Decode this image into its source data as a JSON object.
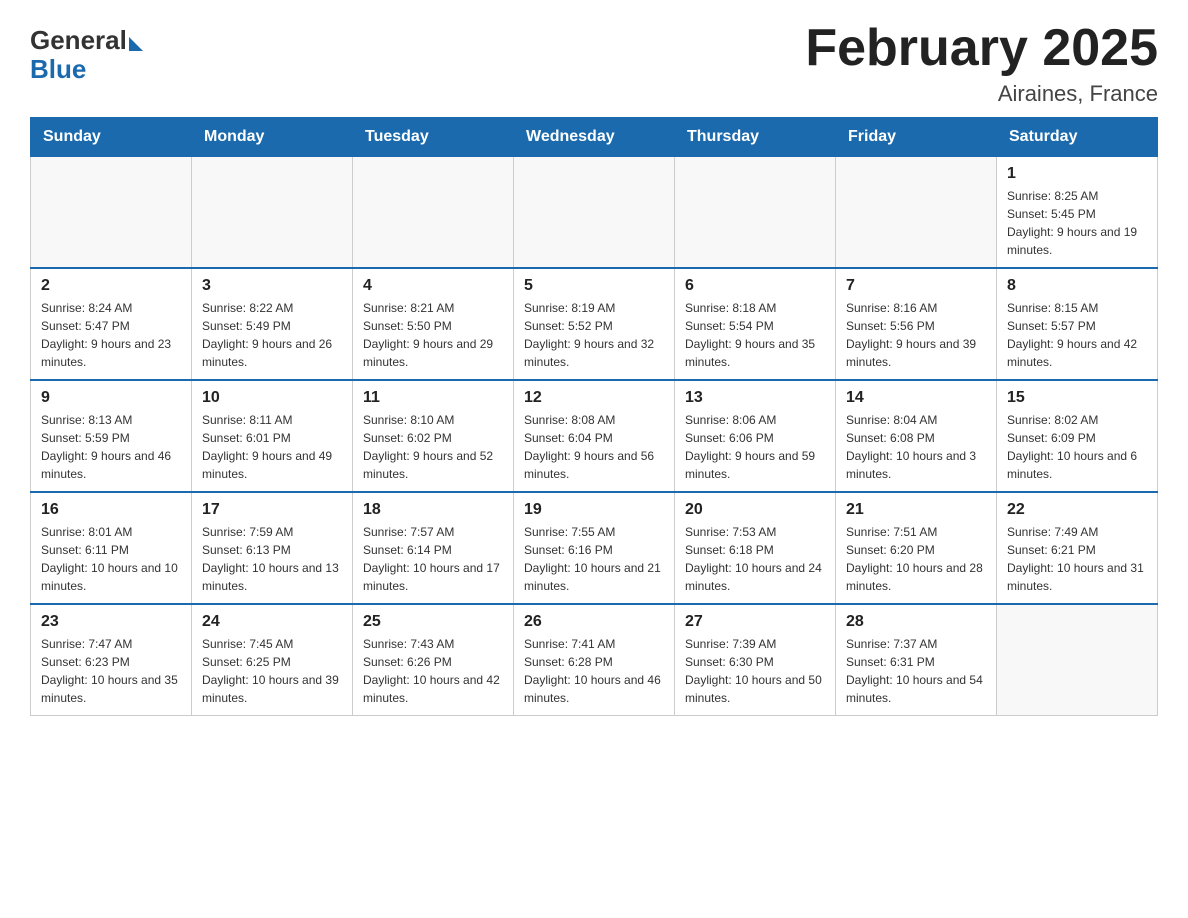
{
  "header": {
    "logo_general": "General",
    "logo_blue": "Blue",
    "title": "February 2025",
    "location": "Airaines, France"
  },
  "days_of_week": [
    "Sunday",
    "Monday",
    "Tuesday",
    "Wednesday",
    "Thursday",
    "Friday",
    "Saturday"
  ],
  "weeks": [
    {
      "days": [
        {
          "number": "",
          "info": "",
          "empty": true
        },
        {
          "number": "",
          "info": "",
          "empty": true
        },
        {
          "number": "",
          "info": "",
          "empty": true
        },
        {
          "number": "",
          "info": "",
          "empty": true
        },
        {
          "number": "",
          "info": "",
          "empty": true
        },
        {
          "number": "",
          "info": "",
          "empty": true
        },
        {
          "number": "1",
          "info": "Sunrise: 8:25 AM\nSunset: 5:45 PM\nDaylight: 9 hours and 19 minutes.",
          "empty": false
        }
      ]
    },
    {
      "days": [
        {
          "number": "2",
          "info": "Sunrise: 8:24 AM\nSunset: 5:47 PM\nDaylight: 9 hours and 23 minutes.",
          "empty": false
        },
        {
          "number": "3",
          "info": "Sunrise: 8:22 AM\nSunset: 5:49 PM\nDaylight: 9 hours and 26 minutes.",
          "empty": false
        },
        {
          "number": "4",
          "info": "Sunrise: 8:21 AM\nSunset: 5:50 PM\nDaylight: 9 hours and 29 minutes.",
          "empty": false
        },
        {
          "number": "5",
          "info": "Sunrise: 8:19 AM\nSunset: 5:52 PM\nDaylight: 9 hours and 32 minutes.",
          "empty": false
        },
        {
          "number": "6",
          "info": "Sunrise: 8:18 AM\nSunset: 5:54 PM\nDaylight: 9 hours and 35 minutes.",
          "empty": false
        },
        {
          "number": "7",
          "info": "Sunrise: 8:16 AM\nSunset: 5:56 PM\nDaylight: 9 hours and 39 minutes.",
          "empty": false
        },
        {
          "number": "8",
          "info": "Sunrise: 8:15 AM\nSunset: 5:57 PM\nDaylight: 9 hours and 42 minutes.",
          "empty": false
        }
      ]
    },
    {
      "days": [
        {
          "number": "9",
          "info": "Sunrise: 8:13 AM\nSunset: 5:59 PM\nDaylight: 9 hours and 46 minutes.",
          "empty": false
        },
        {
          "number": "10",
          "info": "Sunrise: 8:11 AM\nSunset: 6:01 PM\nDaylight: 9 hours and 49 minutes.",
          "empty": false
        },
        {
          "number": "11",
          "info": "Sunrise: 8:10 AM\nSunset: 6:02 PM\nDaylight: 9 hours and 52 minutes.",
          "empty": false
        },
        {
          "number": "12",
          "info": "Sunrise: 8:08 AM\nSunset: 6:04 PM\nDaylight: 9 hours and 56 minutes.",
          "empty": false
        },
        {
          "number": "13",
          "info": "Sunrise: 8:06 AM\nSunset: 6:06 PM\nDaylight: 9 hours and 59 minutes.",
          "empty": false
        },
        {
          "number": "14",
          "info": "Sunrise: 8:04 AM\nSunset: 6:08 PM\nDaylight: 10 hours and 3 minutes.",
          "empty": false
        },
        {
          "number": "15",
          "info": "Sunrise: 8:02 AM\nSunset: 6:09 PM\nDaylight: 10 hours and 6 minutes.",
          "empty": false
        }
      ]
    },
    {
      "days": [
        {
          "number": "16",
          "info": "Sunrise: 8:01 AM\nSunset: 6:11 PM\nDaylight: 10 hours and 10 minutes.",
          "empty": false
        },
        {
          "number": "17",
          "info": "Sunrise: 7:59 AM\nSunset: 6:13 PM\nDaylight: 10 hours and 13 minutes.",
          "empty": false
        },
        {
          "number": "18",
          "info": "Sunrise: 7:57 AM\nSunset: 6:14 PM\nDaylight: 10 hours and 17 minutes.",
          "empty": false
        },
        {
          "number": "19",
          "info": "Sunrise: 7:55 AM\nSunset: 6:16 PM\nDaylight: 10 hours and 21 minutes.",
          "empty": false
        },
        {
          "number": "20",
          "info": "Sunrise: 7:53 AM\nSunset: 6:18 PM\nDaylight: 10 hours and 24 minutes.",
          "empty": false
        },
        {
          "number": "21",
          "info": "Sunrise: 7:51 AM\nSunset: 6:20 PM\nDaylight: 10 hours and 28 minutes.",
          "empty": false
        },
        {
          "number": "22",
          "info": "Sunrise: 7:49 AM\nSunset: 6:21 PM\nDaylight: 10 hours and 31 minutes.",
          "empty": false
        }
      ]
    },
    {
      "days": [
        {
          "number": "23",
          "info": "Sunrise: 7:47 AM\nSunset: 6:23 PM\nDaylight: 10 hours and 35 minutes.",
          "empty": false
        },
        {
          "number": "24",
          "info": "Sunrise: 7:45 AM\nSunset: 6:25 PM\nDaylight: 10 hours and 39 minutes.",
          "empty": false
        },
        {
          "number": "25",
          "info": "Sunrise: 7:43 AM\nSunset: 6:26 PM\nDaylight: 10 hours and 42 minutes.",
          "empty": false
        },
        {
          "number": "26",
          "info": "Sunrise: 7:41 AM\nSunset: 6:28 PM\nDaylight: 10 hours and 46 minutes.",
          "empty": false
        },
        {
          "number": "27",
          "info": "Sunrise: 7:39 AM\nSunset: 6:30 PM\nDaylight: 10 hours and 50 minutes.",
          "empty": false
        },
        {
          "number": "28",
          "info": "Sunrise: 7:37 AM\nSunset: 6:31 PM\nDaylight: 10 hours and 54 minutes.",
          "empty": false
        },
        {
          "number": "",
          "info": "",
          "empty": true
        }
      ]
    }
  ]
}
